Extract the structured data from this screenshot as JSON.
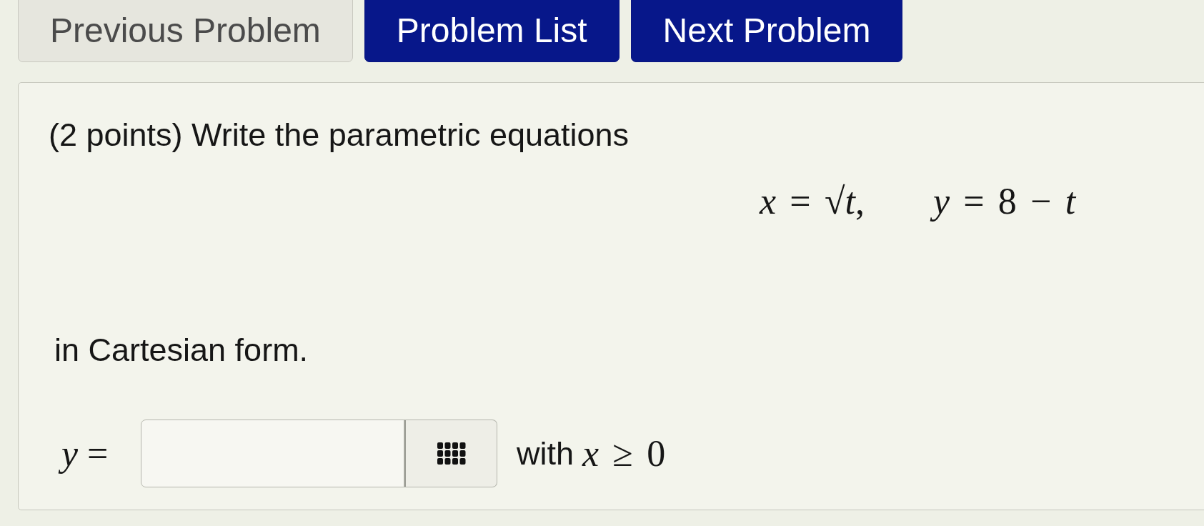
{
  "nav_buttons": [
    {
      "label": "Previous Problem",
      "disabled": true
    },
    {
      "label": "Problem List",
      "disabled": false
    },
    {
      "label": "Next Problem",
      "disabled": false
    }
  ],
  "problem": {
    "prompt": "(2 points) Write the parametric equations",
    "equations": [
      "*x* = √*t*,",
      "*y* = 8 − *t*"
    ],
    "instruction": "in Cartesian form.",
    "answer": {
      "label": "*y* =",
      "condition_text": "with",
      "condition_math": "*x* ≥ 0"
    }
  }
}
